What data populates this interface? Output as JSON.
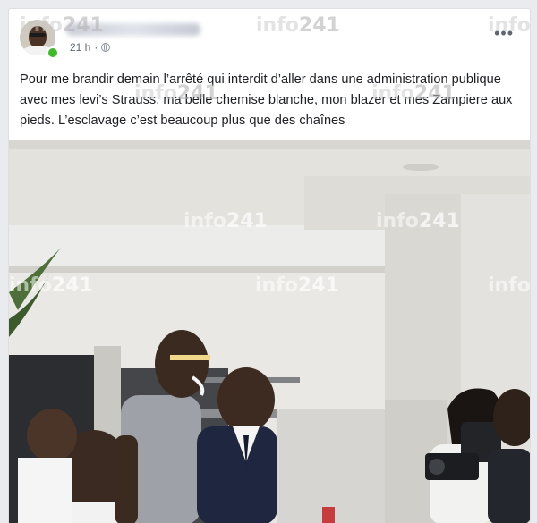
{
  "post": {
    "timestamp": "21 h",
    "separator": "·",
    "privacy_icon": "globe-icon",
    "more_icon": "more-options-icon",
    "text": "Pour me brandir demain l’arrêté qui interdit d’aller dans une administration publique avec mes levi’s Strauss, ma belle chemise blanche, mon blazer et mes Zampiere aux pieds. L’esclavage c’est beaucoup plus que des chaînes"
  },
  "watermark": {
    "text": "info",
    "number": "241"
  },
  "colors": {
    "background": "#e9ebee",
    "card": "#ffffff",
    "text": "#1c1e21",
    "meta": "#606770",
    "online": "#42b72a"
  }
}
